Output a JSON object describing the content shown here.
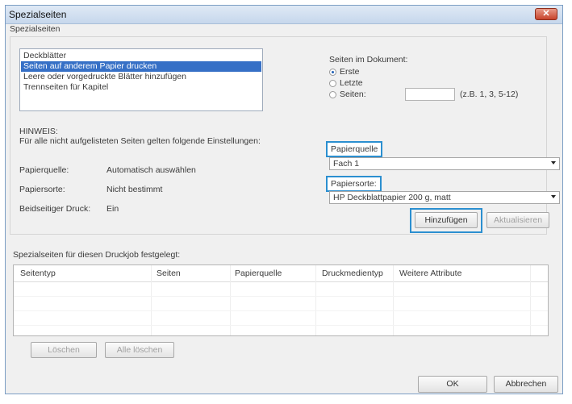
{
  "window": {
    "title": "Spezialseiten"
  },
  "group": {
    "label": "Spezialseiten"
  },
  "page_types": [
    {
      "label": "Deckblätter",
      "selected": false
    },
    {
      "label": "Seiten auf anderem Papier drucken",
      "selected": true
    },
    {
      "label": "Leere oder vorgedruckte Blätter hinzufügen",
      "selected": false
    },
    {
      "label": "Trennseiten für Kapitel",
      "selected": false
    }
  ],
  "document_pages": {
    "label": "Seiten im Dokument:",
    "options": [
      {
        "label": "Erste",
        "checked": true
      },
      {
        "label": "Letzte",
        "checked": false
      },
      {
        "label": "Seiten:",
        "checked": false
      }
    ],
    "pages_input_value": "",
    "pages_example": "(z.B. 1, 3, 5-12)"
  },
  "note": {
    "title": "HINWEIS:",
    "text": "Für alle nicht aufgelisteten Seiten gelten folgende Einstellungen:",
    "settings": [
      {
        "label": "Papierquelle:",
        "value": "Automatisch auswählen"
      },
      {
        "label": "Papiersorte:",
        "value": "Nicht bestimmt"
      },
      {
        "label": "Beidseitiger Druck:",
        "value": "Ein"
      }
    ]
  },
  "paper_source": {
    "label": "Papierquelle",
    "value": "Fach 1"
  },
  "paper_type": {
    "label": "Papiersorte:",
    "value": "HP Deckblattpapier 200 g, matt"
  },
  "buttons": {
    "add": "Hinzufügen",
    "update": "Aktualisieren",
    "delete": "Löschen",
    "delete_all": "Alle löschen",
    "ok": "OK",
    "cancel": "Abbrechen"
  },
  "job_table": {
    "label": "Spezialseiten für diesen Druckjob festgelegt:",
    "columns": [
      "Seitentyp",
      "Seiten",
      "Papierquelle",
      "Druckmedientyp",
      "Weitere Attribute"
    ],
    "rows": []
  },
  "colors": {
    "highlight": "#2b8fd0",
    "selection": "#3670c6",
    "close": "#c7432b"
  }
}
